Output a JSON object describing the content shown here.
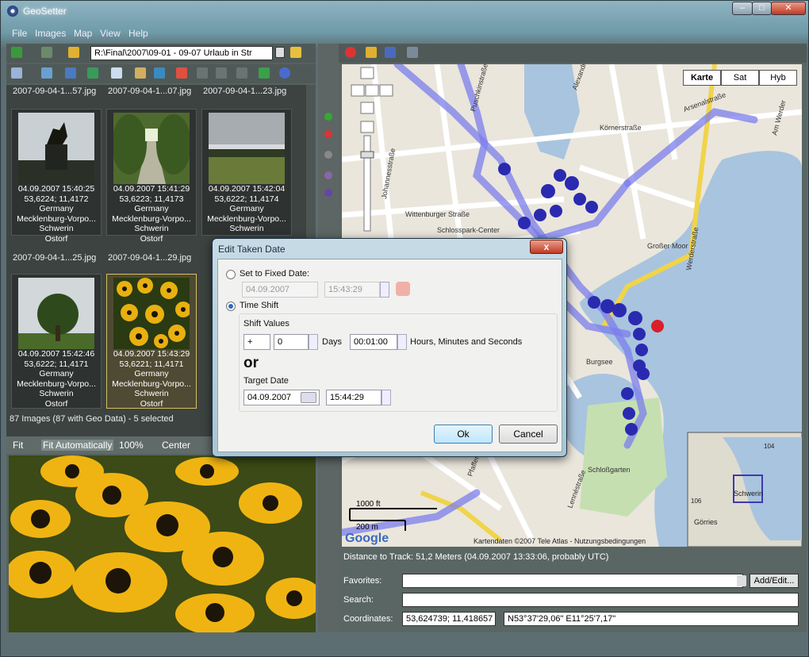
{
  "window": {
    "title": "GeoSetter",
    "controls": [
      "–",
      "□",
      "✕"
    ]
  },
  "menu": [
    "File",
    "Images",
    "Map",
    "View",
    "Help"
  ],
  "path": {
    "value": "R:\\Final\\2007\\09-01 - 09-07 Urlaub in Str"
  },
  "thumbnails": [
    {
      "name": "2007-09-04-1...57.jpg",
      "date": "04.09.2007 15:40:25",
      "coords": "53,6224; 11,4172",
      "country": "Germany",
      "region": "Mecklenburg-Vorpo...",
      "city": "Schwerin",
      "place": "Ostorf",
      "selected": false,
      "image": "statue"
    },
    {
      "name": "2007-09-04-1...07.jpg",
      "date": "04.09.2007 15:41:29",
      "coords": "53,6223; 11,4173",
      "country": "Germany",
      "region": "Mecklenburg-Vorpo...",
      "city": "Schwerin",
      "place": "Ostorf",
      "selected": false,
      "image": "alley"
    },
    {
      "name": "2007-09-04-1...23.jpg",
      "date": "04.09.2007 15:42:04",
      "coords": "53,6222; 11,4174",
      "country": "Germany",
      "region": "Mecklenburg-Vorpo...",
      "city": "Schwerin",
      "place": "",
      "selected": false,
      "image": "landscape"
    },
    {
      "name": "2007-09-04-1...25.jpg",
      "date": "04.09.2007 15:42:46",
      "coords": "53,6222; 11,4171",
      "country": "Germany",
      "region": "Mecklenburg-Vorpo...",
      "city": "Schwerin",
      "place": "Ostorf",
      "selected": false,
      "image": "tree"
    },
    {
      "name": "2007-09-04-1...29.jpg",
      "date": "04.09.2007 15:43:29",
      "coords": "53,6221; 11,4171",
      "country": "Germany",
      "region": "Mecklenburg-Vorpo...",
      "city": "Schwerin",
      "place": "Ostorf",
      "selected": true,
      "image": "flowers"
    }
  ],
  "status": {
    "images": "87 Images (87 with Geo Data) - 5 selected"
  },
  "zoom": {
    "fit": "Fit",
    "fit_auto": "Fit Automatically",
    "percent": "100%",
    "center": "Center"
  },
  "map": {
    "types": [
      "Karte",
      "Sat",
      "Hyb"
    ],
    "scale_ft": "1000 ft",
    "scale_m": "200 m",
    "copyright": "Kartendaten ©2007 Tele Atlas - Nutzungsbedingungen",
    "google": "Google",
    "streets": [
      "Alexandrinenstraße",
      "Körnerstraße",
      "Wittenburger Straße",
      "Schlosspark-Center",
      "Großer Moor",
      "Burgsee",
      "Schloßgarten",
      "Werderstraße",
      "Johannesstraße",
      "Puschkinstraße",
      "Am Werder",
      "Arsenalstraße",
      "Lennéstraße",
      "Pfaffenteichstraße"
    ],
    "inset": {
      "city": "Schwerin",
      "town": "Görries",
      "road": "104",
      "road2": "106"
    }
  },
  "distance": "Distance to Track: 51,2 Meters (04.09.2007 13:33:06, probably UTC)",
  "favorites": {
    "label": "Favorites:",
    "value": "",
    "button": "Add/Edit..."
  },
  "search": {
    "label": "Search:",
    "value": ""
  },
  "coordinates": {
    "label": "Coordinates:",
    "decimal": "53,624739; 11,418657",
    "dms": "N53°37'29,06\" E11°25'7,17\""
  },
  "dialog": {
    "title": "Edit Taken Date",
    "fixed_label": "Set to Fixed Date:",
    "fixed_date": "04.09.2007",
    "fixed_time": "15:43:29",
    "timeshift_label": "Time Shift",
    "shift_values": "Shift Values",
    "sign": "+",
    "days_value": "0",
    "days_label": "Days",
    "hm_value": "00:01:00",
    "hm_label": "Hours, Minutes and Seconds",
    "or": "or",
    "target_label": "Target Date",
    "target_date": "04.09.2007",
    "target_time": "15:44:29",
    "ok": "Ok",
    "cancel": "Cancel",
    "close": "x"
  },
  "colors": {
    "route": "#7b7dec",
    "marker": "#2a2ab0",
    "marker_selected": "#d8202a",
    "water": "#a9c4de",
    "park": "#c6dfb1",
    "accent": "#d7c061"
  }
}
